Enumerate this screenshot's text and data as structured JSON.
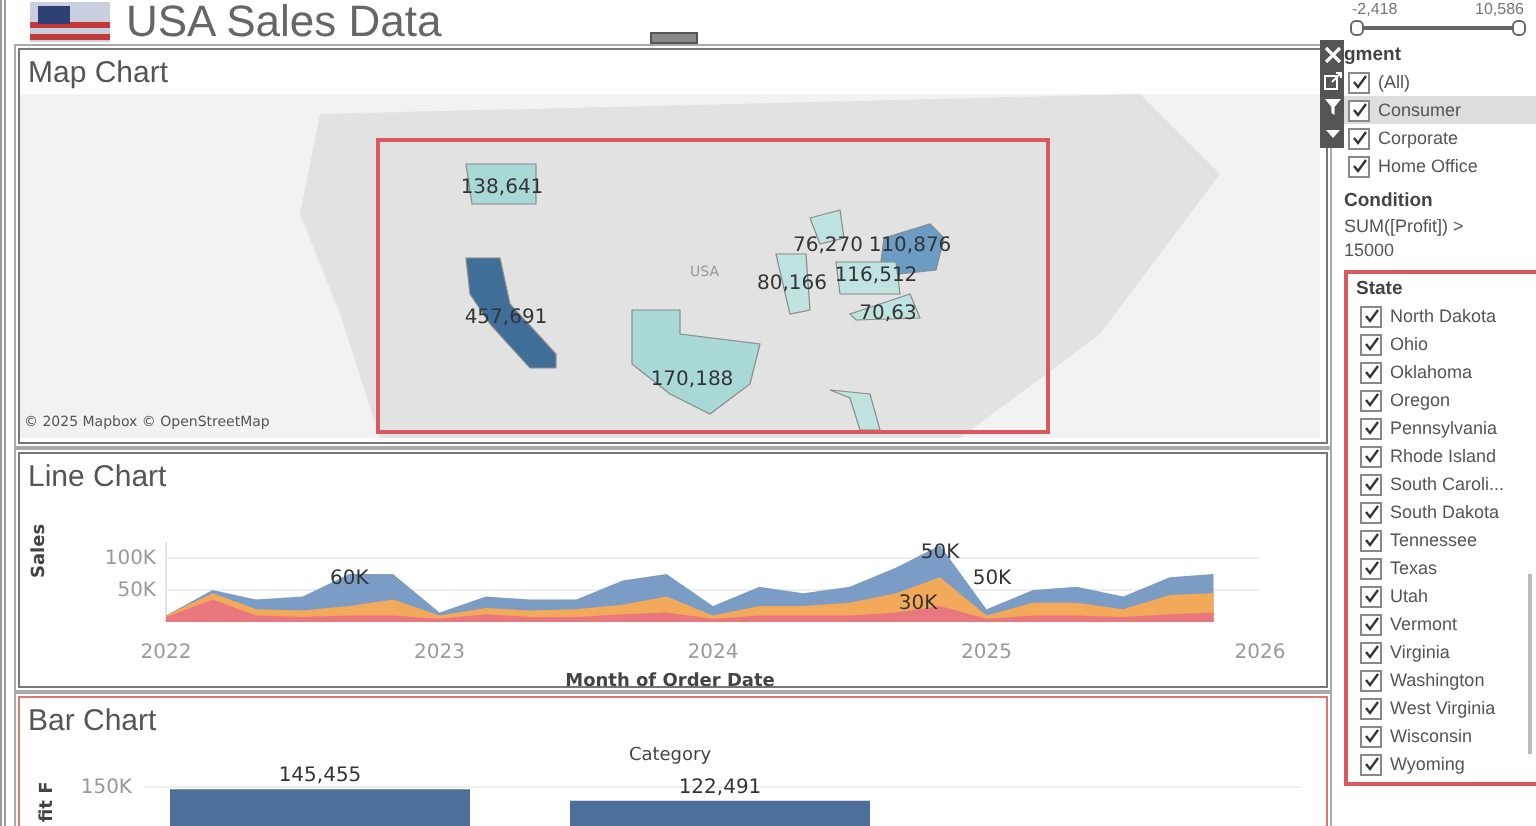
{
  "header": {
    "title": "USA Sales Data"
  },
  "map_panel": {
    "title": "Map Chart",
    "attribution": "© 2025 Mapbox © OpenStreetMap",
    "country_label": "USA",
    "regions": [
      {
        "label": "138,641",
        "color": "#a9d9d6"
      },
      {
        "label": "457,691",
        "color": "#3f6e98"
      },
      {
        "label": "170,188",
        "color": "#a9d9d6"
      },
      {
        "label": "110,876",
        "color": "#6a9cc4"
      },
      {
        "label": "80,166",
        "color": "#bfe3df"
      },
      {
        "label": "76,270",
        "color": "#bfe3df"
      },
      {
        "label": "116,512",
        "color": "#bfe3df"
      },
      {
        "label": "70,63",
        "color": "#bfe3df"
      },
      {
        "color": "#bfe3df"
      }
    ]
  },
  "line_panel": {
    "title": "Line Chart",
    "chart_data": {
      "type": "area",
      "xlabel": "Month of Order Date",
      "ylabel": "Sales",
      "xlim": [
        2022,
        2026
      ],
      "ylim": [
        0,
        125
      ],
      "x": [
        2022.0,
        2022.17,
        2022.33,
        2022.5,
        2022.67,
        2022.83,
        2023.0,
        2023.17,
        2023.33,
        2023.5,
        2023.67,
        2023.83,
        2024.0,
        2024.17,
        2024.33,
        2024.5,
        2024.67,
        2024.83,
        2025.0,
        2025.17,
        2025.33,
        2025.5,
        2025.67,
        2025.83
      ],
      "series": [
        {
          "color": "#7b9cc4",
          "values": [
            10,
            50,
            35,
            40,
            75,
            75,
            15,
            40,
            35,
            35,
            65,
            75,
            25,
            55,
            45,
            55,
            85,
            120,
            20,
            50,
            55,
            40,
            70,
            75
          ]
        },
        {
          "color": "#f3a95a",
          "values": [
            10,
            45,
            20,
            18,
            25,
            35,
            10,
            22,
            18,
            20,
            27,
            40,
            10,
            25,
            25,
            30,
            45,
            70,
            10,
            30,
            30,
            20,
            42,
            45
          ]
        },
        {
          "color": "#e8787e",
          "values": [
            8,
            35,
            10,
            8,
            10,
            10,
            5,
            12,
            8,
            8,
            12,
            15,
            5,
            10,
            10,
            10,
            15,
            25,
            5,
            10,
            10,
            8,
            12,
            15
          ]
        }
      ],
      "xticks": [
        2022,
        2023,
        2024,
        2025,
        2026
      ],
      "yticks": [
        {
          "value": 50,
          "label": "50K"
        },
        {
          "value": 100,
          "label": "100K"
        }
      ],
      "annotations": [
        "60K",
        "50K",
        "50K",
        "30K"
      ]
    }
  },
  "bar_panel": {
    "title": "Bar Chart",
    "chart_title": "Category",
    "axis_title": "fit F",
    "y_tick_label": "150K",
    "bars": [
      {
        "label": "145,455"
      },
      {
        "label": "122,491"
      }
    ]
  },
  "filters": {
    "range": {
      "min": "-2,418",
      "max": "10,586",
      "level": 1
    },
    "segment": {
      "title": "gment",
      "items": [
        {
          "label": "(All)",
          "checked": true,
          "selected": false
        },
        {
          "label": "Consumer",
          "checked": true,
          "selected": true
        },
        {
          "label": "Corporate",
          "checked": true,
          "selected": false
        },
        {
          "label": "Home Office",
          "checked": true,
          "selected": false
        }
      ]
    },
    "condition": {
      "title": "Condition",
      "text": "SUM([Profit]) > 15000"
    },
    "state": {
      "title": "State",
      "items": [
        {
          "label": "North Dakota",
          "checked": true
        },
        {
          "label": "Ohio",
          "checked": true
        },
        {
          "label": "Oklahoma",
          "checked": true
        },
        {
          "label": "Oregon",
          "checked": true
        },
        {
          "label": "Pennsylvania",
          "checked": true
        },
        {
          "label": "Rhode Island",
          "checked": true
        },
        {
          "label": "South Caroli...",
          "checked": true
        },
        {
          "label": "South Dakota",
          "checked": true
        },
        {
          "label": "Tennessee",
          "checked": true
        },
        {
          "label": "Texas",
          "checked": true
        },
        {
          "label": "Utah",
          "checked": true
        },
        {
          "label": "Vermont",
          "checked": true
        },
        {
          "label": "Virginia",
          "checked": true
        },
        {
          "label": "Washington",
          "checked": true
        },
        {
          "label": "West Virginia",
          "checked": true
        },
        {
          "label": "Wisconsin",
          "checked": true
        },
        {
          "label": "Wyoming",
          "checked": true
        }
      ]
    }
  }
}
